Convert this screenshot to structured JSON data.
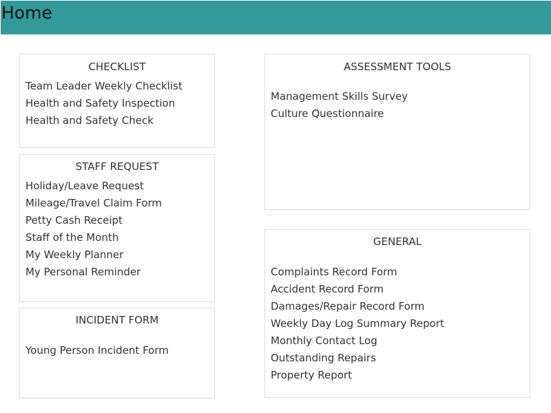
{
  "header": {
    "title": "Home",
    "background_color": "#339999"
  },
  "panels": {
    "checklist": {
      "title": "CHECKLIST",
      "items": [
        "Team Leader Weekly Checklist",
        "Health and Safety Inspection",
        "Health and Safety Check"
      ]
    },
    "staff_request": {
      "title": "STAFF REQUEST",
      "items": [
        "Holiday/Leave Request",
        "Mileage/Travel Claim Form",
        "Petty Cash Receipt",
        "Staff of the Month",
        "My Weekly Planner",
        "My Personal Reminder"
      ]
    },
    "incident_form": {
      "title": "INCIDENT FORM",
      "items": [
        "Young Person Incident Form"
      ]
    },
    "assessment_tools": {
      "title": "ASSESSMENT TOOLS",
      "items": [
        "Management Skills Survey",
        "Culture Questionnaire"
      ]
    },
    "general": {
      "title": "GENERAL",
      "items": [
        "Complaints Record Form",
        "Accident Record Form",
        "Damages/Repair Record Form",
        "Weekly Day Log Summary Report",
        "Monthly Contact Log",
        "Outstanding Repairs",
        "Property Report"
      ]
    }
  }
}
